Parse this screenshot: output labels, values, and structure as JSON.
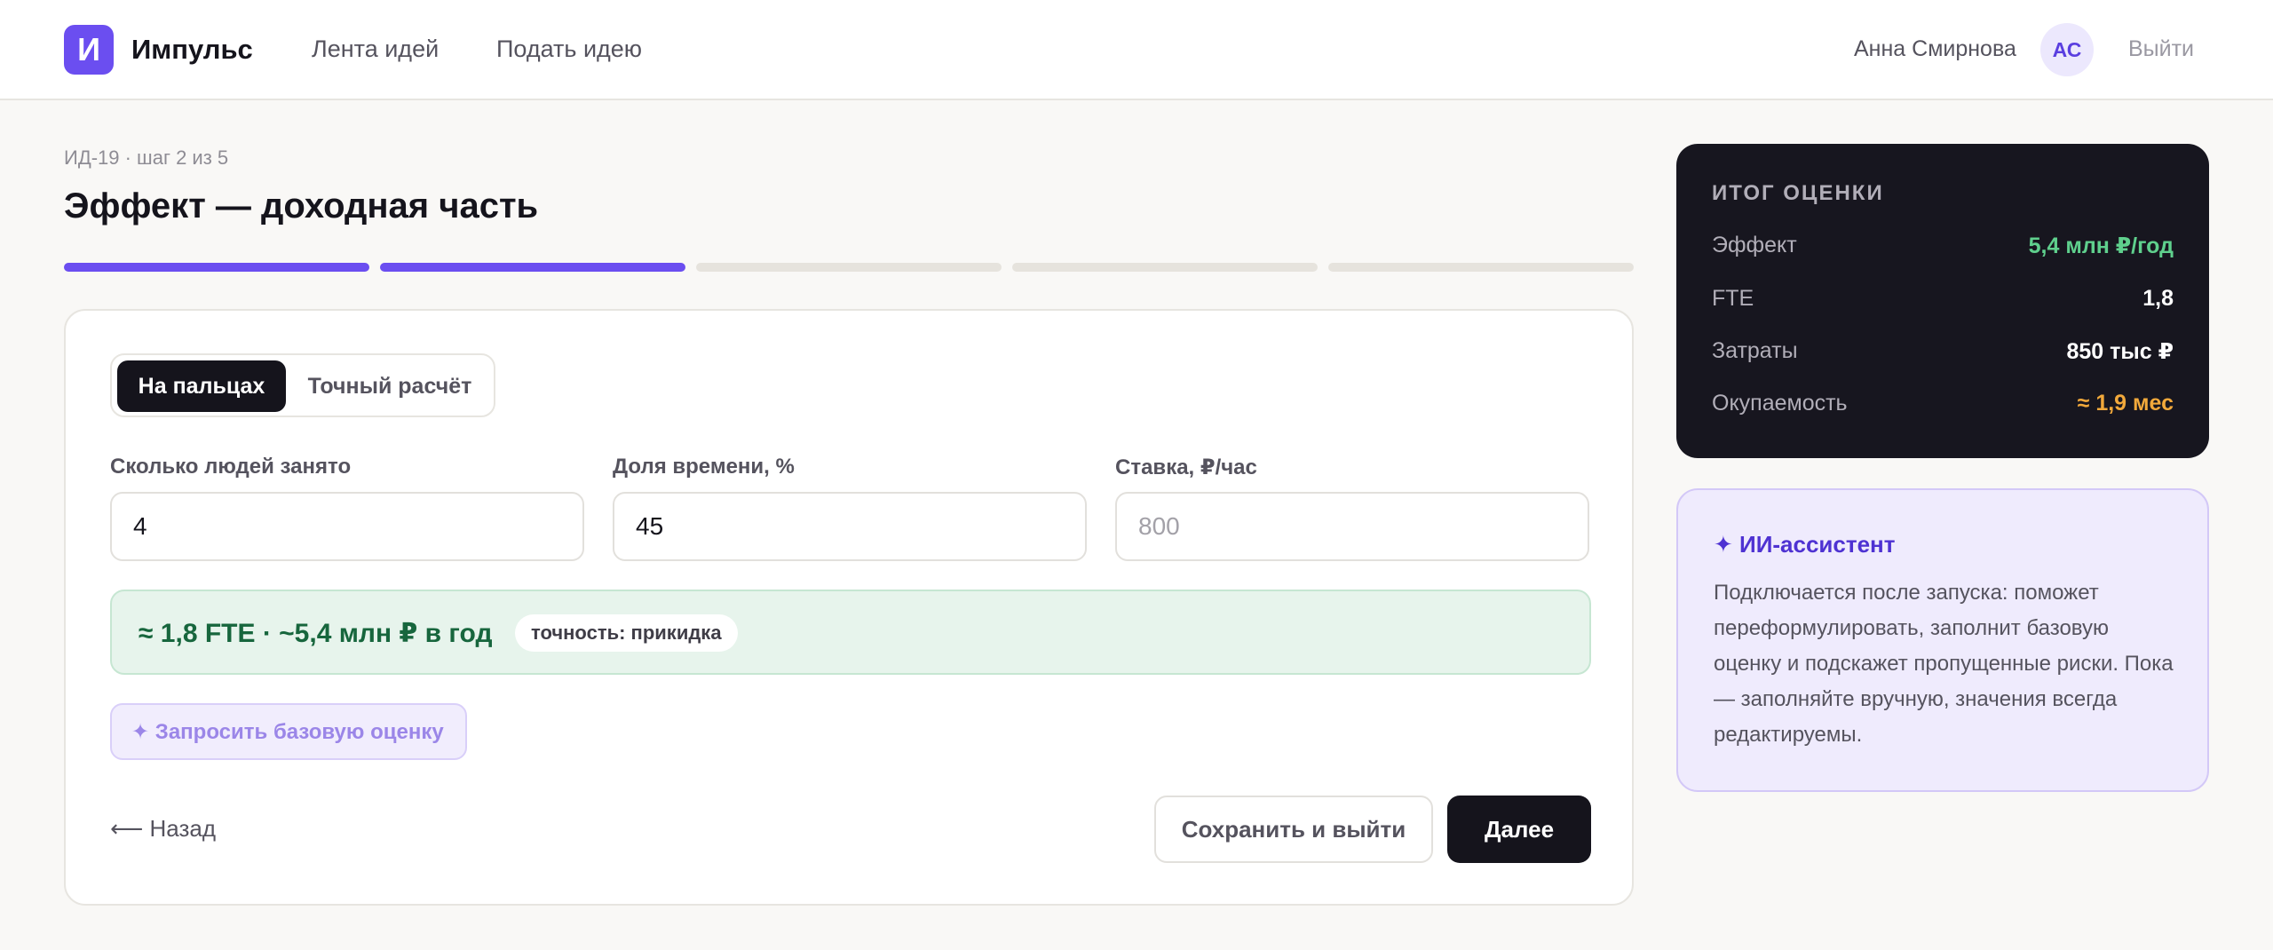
{
  "header": {
    "logo_letter": "И",
    "brand": "Импульс",
    "nav": [
      "Лента идей",
      "Подать идею"
    ],
    "user_name": "Анна Смирнова",
    "avatar_initials": "АС",
    "logout": "Выйти"
  },
  "page": {
    "step_meta": "ИД-19 · шаг 2 из 5",
    "title": "Эффект — доходная часть",
    "progress": {
      "current_step": 2,
      "total_steps": 5
    }
  },
  "form": {
    "modes": {
      "quick": "На пальцах",
      "exact": "Точный расчёт",
      "selected": "На пальцах"
    },
    "fields": [
      {
        "label": "Сколько людей занято",
        "value": "4",
        "placeholder": ""
      },
      {
        "label": "Доля времени, %",
        "value": "45",
        "placeholder": ""
      },
      {
        "label": "Ставка, ₽/час",
        "value": "",
        "placeholder": "800"
      }
    ],
    "result": {
      "text": "≈ 1,8 FTE · ~5,4 млн ₽ в год",
      "accuracy": "точность: прикидка"
    },
    "request_baseline": "✦ Запросить базовую оценку",
    "back": "⟵ Назад",
    "save_exit": "Сохранить и выйти",
    "next": "Далее"
  },
  "summary": {
    "title": "ИТОГ ОЦЕНКИ",
    "rows": [
      {
        "label": "Эффект",
        "value": "5,4 млн ₽/год",
        "color": "#5fd08d"
      },
      {
        "label": "FTE",
        "value": "1,8",
        "color": "#ffffff"
      },
      {
        "label": "Затраты",
        "value": "850 тыс ₽",
        "color": "#ffffff"
      },
      {
        "label": "Окупаемость",
        "value": "≈ 1,9 мес",
        "color": "#f2a93b"
      }
    ]
  },
  "assistant": {
    "title": "✦ ИИ-ассистент",
    "text": "Подключается после запуска: поможет переформулировать, заполнит базовую оценку и подскажет пропущенные риски. Пока — заполняйте вручную, значения всегда редактируемы."
  },
  "colors": {
    "accent": "#6b4ef0",
    "dark": "#15141c",
    "success": "#17663d",
    "warning": "#f2a93b"
  }
}
